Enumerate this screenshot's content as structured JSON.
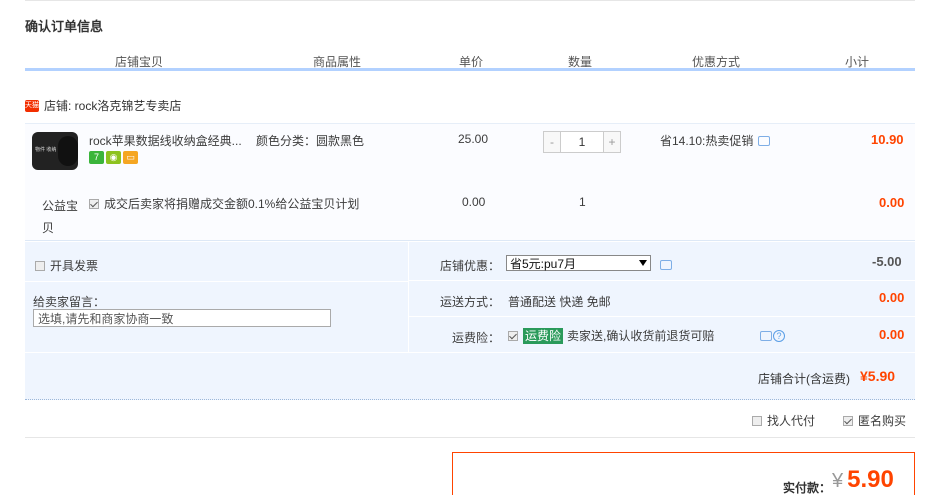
{
  "page_title": "确认订单信息",
  "columns": [
    "店铺宝贝",
    "商品属性",
    "单价",
    "数量",
    "优惠方式",
    "小计"
  ],
  "shop": {
    "badge": "天猫",
    "name": "店铺: rock洛克锦艺专卖店"
  },
  "item": {
    "name": "rock苹果数据线收纳盒经典...",
    "property": "颜色分类：圆款黑色",
    "price": "25.00",
    "quantity": "1",
    "qty_minus": "-",
    "qty_plus": "+",
    "promotion": "省14.10:热卖促销",
    "subtotal": "10.90",
    "thumb_text": "物件 收纳"
  },
  "charity": {
    "label": "公益宝贝",
    "text": "成交后卖家将捐赠成交金额0.1%给公益宝贝计划",
    "price": "0.00",
    "quantity": "1",
    "subtotal": "0.00"
  },
  "invoice_label": "开具发票",
  "message": {
    "label": "给卖家留言：",
    "placeholder": "选填,请先和商家协商一致"
  },
  "shop_discount": {
    "label": "店铺优惠：",
    "selected": "省5元:pu7月",
    "amount": "-5.00"
  },
  "shipping": {
    "label": "运送方式：",
    "value": "普通配送 快递 免邮",
    "amount": "0.00"
  },
  "insurance": {
    "label": "运费险：",
    "tag": "运费险",
    "text": "卖家送,确认收货前退货可赔",
    "amount": "0.00"
  },
  "shop_total": {
    "label": "店铺合计(含运费)",
    "amount": "¥5.90"
  },
  "options": {
    "proxy_pay": "找人代付",
    "anonymous": "匿名购买"
  },
  "payment": {
    "label": "实付款：",
    "currency": "¥",
    "amount": "5.90"
  },
  "colors": {
    "accent": "#ff4400",
    "header_line": "#b2d1ff",
    "panel_bg": "#eff5fe"
  }
}
